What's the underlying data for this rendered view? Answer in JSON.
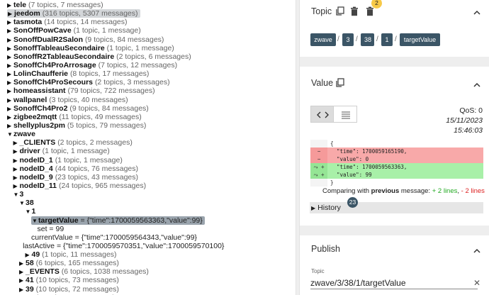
{
  "tree": {
    "rows": [
      {
        "indent": 0,
        "arrow": "right",
        "name": "tele",
        "meta": "(7 topics, 7 messages)"
      },
      {
        "indent": 0,
        "arrow": "right",
        "name": "jeedom",
        "meta": "(316 topics, 5307 messages)",
        "highlight": "light"
      },
      {
        "indent": 0,
        "arrow": "right",
        "name": "tasmota",
        "meta": "(14 topics, 14 messages)"
      },
      {
        "indent": 0,
        "arrow": "right",
        "name": "SonOffPowCave",
        "meta": "(1 topic, 1 message)"
      },
      {
        "indent": 0,
        "arrow": "right",
        "name": "SonoffDualR2Salon",
        "meta": "(9 topics, 84 messages)"
      },
      {
        "indent": 0,
        "arrow": "right",
        "name": "SonoffTableauSecondaire",
        "meta": "(1 topic, 1 message)"
      },
      {
        "indent": 0,
        "arrow": "right",
        "name": "SonoffR2TableauSecondaire",
        "meta": "(2 topics, 6 messages)"
      },
      {
        "indent": 0,
        "arrow": "right",
        "name": "SonoffCh4ProArrosage",
        "meta": "(7 topics, 12 messages)"
      },
      {
        "indent": 0,
        "arrow": "right",
        "name": "LolinChaufferie",
        "meta": "(8 topics, 17 messages)"
      },
      {
        "indent": 0,
        "arrow": "right",
        "name": "SonoffCh4ProSecours",
        "meta": "(2 topics, 3 messages)"
      },
      {
        "indent": 0,
        "arrow": "right",
        "name": "homeassistant",
        "meta": "(79 topics, 722 messages)"
      },
      {
        "indent": 0,
        "arrow": "right",
        "name": "wallpanel",
        "meta": "(3 topics, 40 messages)"
      },
      {
        "indent": 0,
        "arrow": "right",
        "name": "SonoffCh4Pro2",
        "meta": "(9 topics, 84 messages)"
      },
      {
        "indent": 0,
        "arrow": "right",
        "name": "zigbee2mqtt",
        "meta": "(11 topics, 49 messages)"
      },
      {
        "indent": 0,
        "arrow": "right",
        "name": "shellyplus2pm",
        "meta": "(5 topics, 79 messages)"
      },
      {
        "indent": 0,
        "arrow": "down",
        "name": "zwave",
        "meta": ""
      },
      {
        "indent": 1,
        "arrow": "right",
        "name": "_CLIENTS",
        "meta": "(2 topics, 2 messages)"
      },
      {
        "indent": 1,
        "arrow": "right",
        "name": "driver",
        "meta": "(1 topic, 1 message)"
      },
      {
        "indent": 1,
        "arrow": "right",
        "name": "nodeID_1",
        "meta": "(1 topic, 1 message)"
      },
      {
        "indent": 1,
        "arrow": "right",
        "name": "nodeID_4",
        "meta": "(44 topics, 76 messages)"
      },
      {
        "indent": 1,
        "arrow": "right",
        "name": "nodeID_9",
        "meta": "(23 topics, 43 messages)"
      },
      {
        "indent": 1,
        "arrow": "right",
        "name": "nodeID_11",
        "meta": "(24 topics, 965 messages)"
      },
      {
        "indent": 1,
        "arrow": "down",
        "name": "3",
        "meta": ""
      },
      {
        "indent": 2,
        "arrow": "down",
        "name": "38",
        "meta": ""
      },
      {
        "indent": 3,
        "arrow": "down",
        "name": "1",
        "meta": ""
      },
      {
        "indent": 4,
        "arrow": "down",
        "name": "targetValue",
        "value": " = {\"time\":1700059563363,\"value\":99}",
        "highlight": "dark"
      },
      {
        "indent": 5,
        "arrow": "none",
        "name": "",
        "value": "set = 99"
      },
      {
        "indent": 4,
        "arrow": "none",
        "name": "",
        "value": "currentValue = {\"time\":1700059564343,\"value\":99}"
      },
      {
        "indent": 2.6,
        "arrow": "none",
        "name": "",
        "value": "lastActive = {\"time\":1700059570351,\"value\":1700059570100}"
      },
      {
        "indent": 3,
        "arrow": "right",
        "name": "49",
        "meta": "(1 topic, 11 messages)"
      },
      {
        "indent": 2,
        "arrow": "right",
        "name": "58",
        "meta": "(6 topics, 165 messages)"
      },
      {
        "indent": 2,
        "arrow": "right",
        "name": "_EVENTS",
        "meta": "(6 topics, 1038 messages)"
      },
      {
        "indent": 2,
        "arrow": "right",
        "name": "41",
        "meta": "(10 topics, 73 messages)"
      },
      {
        "indent": 2,
        "arrow": "right",
        "name": "39",
        "meta": "(10 topics, 72 messages)"
      },
      {
        "indent": 2,
        "arrow": "right",
        "name": "30",
        "meta": "(6 topics, 17 messages)"
      }
    ]
  },
  "topic_card": {
    "title": "Topic",
    "badge": "2",
    "chips": [
      "zwave",
      "3",
      "38",
      "1",
      "targetValue"
    ],
    "separator": "/"
  },
  "value_card": {
    "title": "Value",
    "qos": "QoS: 0",
    "date": "15/11/2023",
    "time": "15:46:03",
    "diff_lines": [
      {
        "kind": "neu",
        "gutter": "",
        "text": "{"
      },
      {
        "kind": "del",
        "gutter": "−",
        "text": "  \"time\": 1700059165190,"
      },
      {
        "kind": "del",
        "gutter": "−",
        "text": "  \"value\": 0"
      },
      {
        "kind": "add",
        "gutter": "⤳ +",
        "text": "  \"time\": 1700059563363,"
      },
      {
        "kind": "add",
        "gutter": "⤳ +",
        "text": "  \"value\": 99"
      },
      {
        "kind": "neu",
        "gutter": "",
        "text": "}"
      }
    ],
    "compare_prefix": "Comparing with ",
    "compare_bold": "previous",
    "compare_mid": " message: ",
    "compare_added": "+ 2 lines",
    "compare_sep": ", ",
    "compare_removed": "- 2 lines",
    "history_label": "History",
    "history_badge": "23"
  },
  "publish_card": {
    "title": "Publish",
    "topic_label": "Topic",
    "topic_value": "zwave/3/38/1/targetValue"
  },
  "colors": {
    "chip": "#3b5566",
    "badge_yellow": "#f7c948",
    "badge_dark": "#3b5566",
    "added": "#22aa22",
    "removed": "#dd2222",
    "del_bg": "#f8a9a9",
    "add_bg": "#a8f0a8"
  }
}
